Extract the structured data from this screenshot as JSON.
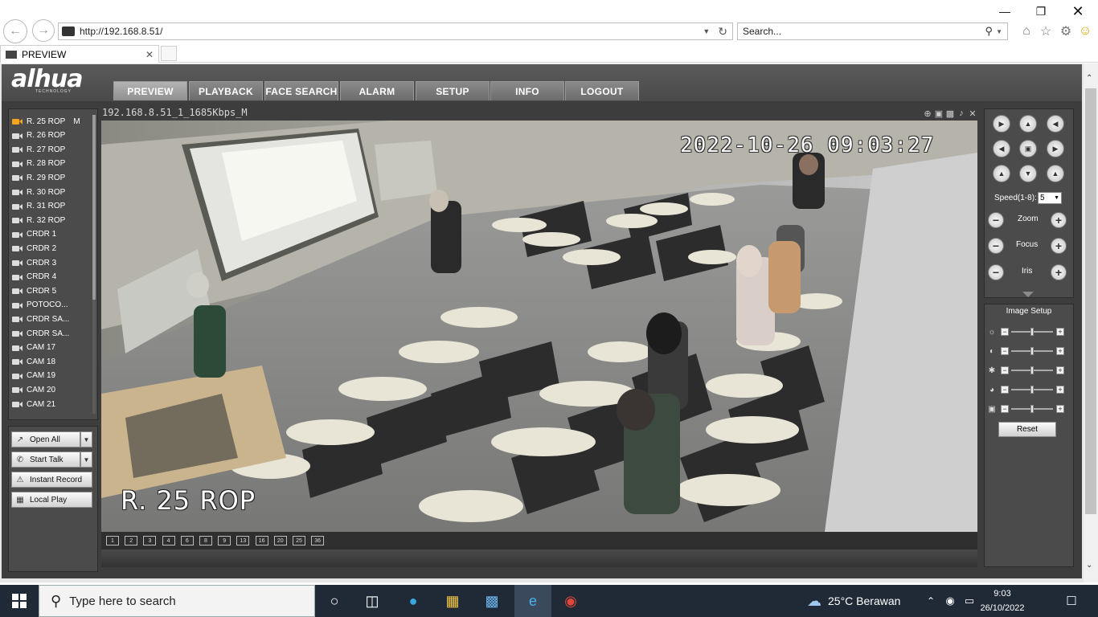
{
  "browser": {
    "address": "http://192.168.8.51/",
    "search_placeholder": "Search...",
    "tab_title": "PREVIEW"
  },
  "app": {
    "brand": "alhua",
    "brand_sub": "TECHNOLOGY",
    "menu": [
      "PREVIEW",
      "PLAYBACK",
      "FACE SEARCH",
      "ALARM",
      "SETUP",
      "INFO",
      "LOGOUT"
    ],
    "active_menu": "PREVIEW"
  },
  "channels": [
    {
      "label": "R. 25 ROP",
      "flag": "M",
      "active": true
    },
    {
      "label": "R. 26 ROP"
    },
    {
      "label": "R. 27 ROP"
    },
    {
      "label": "R. 28 ROP"
    },
    {
      "label": "R. 29 ROP"
    },
    {
      "label": "R. 30 ROP"
    },
    {
      "label": "R. 31 ROP"
    },
    {
      "label": "R. 32 ROP"
    },
    {
      "label": "CRDR 1"
    },
    {
      "label": "CRDR 2"
    },
    {
      "label": "CRDR 3"
    },
    {
      "label": "CRDR 4"
    },
    {
      "label": "CRDR 5"
    },
    {
      "label": "POTOCO..."
    },
    {
      "label": "CRDR SA..."
    },
    {
      "label": "CRDR SA..."
    },
    {
      "label": "CAM 17"
    },
    {
      "label": "CAM 18"
    },
    {
      "label": "CAM 19"
    },
    {
      "label": "CAM 20"
    },
    {
      "label": "CAM 21"
    }
  ],
  "actions": {
    "open_all": "Open All",
    "start_talk": "Start Talk",
    "instant_record": "Instant Record",
    "local_play": "Local Play"
  },
  "video": {
    "stream_info": "192.168.8.51_1_1685Kbps_M",
    "timestamp": "2022-10-26 09:03:27",
    "camera_label": "R. 25 ROP",
    "layout_buttons": [
      "1",
      "2",
      "3",
      "4",
      "6",
      "8",
      "9",
      "13",
      "16",
      "20",
      "25",
      "36"
    ]
  },
  "ptz": {
    "speed_label": "Speed(1-8):",
    "speed_value": "5",
    "zoom_label": "Zoom",
    "focus_label": "Focus",
    "iris_label": "Iris"
  },
  "image_setup": {
    "title": "Image Setup",
    "reset_label": "Reset",
    "rows": [
      "brightness-icon",
      "contrast-icon",
      "saturation-icon",
      "hue-icon",
      "gamma-icon"
    ]
  },
  "taskbar": {
    "search_placeholder": "Type here to search",
    "weather": "25°C  Berawan",
    "time": "9:03",
    "date": "26/10/2022"
  }
}
